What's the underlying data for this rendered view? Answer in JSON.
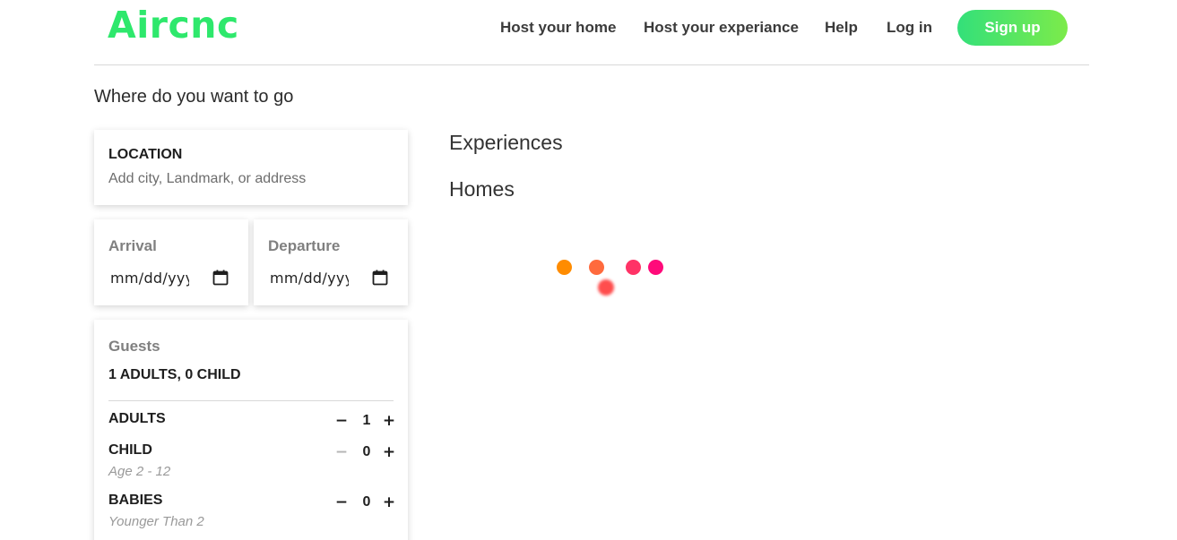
{
  "nav": {
    "logo": "Aircnc",
    "links": [
      "Host your home",
      "Host your experiance",
      "Help",
      "Log in"
    ],
    "signup_label": "Sign up"
  },
  "search": {
    "question": "Where do you want to go",
    "location": {
      "label": "LOCATION",
      "placeholder": "Add city, Landmark, or address"
    },
    "arrival": {
      "label": "Arrival",
      "value": "mm/dd/yyyy"
    },
    "departure": {
      "label": "Departure",
      "value": "mm/dd/yyyy"
    },
    "guests": {
      "label": "Guests",
      "summary": "1 ADULTS, 0 CHILD",
      "rows": [
        {
          "label": "ADULTS",
          "sub": "",
          "value": "1",
          "minus": "−",
          "plus": "+"
        },
        {
          "label": "CHILD",
          "sub": "Age 2 - 12",
          "value": "0",
          "minus": "−",
          "plus": "+"
        },
        {
          "label": "BABIES",
          "sub": "Younger Than 2",
          "value": "0",
          "minus": "−",
          "plus": "+"
        }
      ]
    }
  },
  "results": {
    "experiences_title": "Experiences",
    "homes_title": "Homes"
  },
  "colors": {
    "brand": "#2ee86c",
    "signup_gradient": [
      "#33e07a",
      "#7ceb4a"
    ],
    "loader_dots": [
      "#ff8c00",
      "#ff6a3d",
      "#ff3366",
      "#ff0a7a",
      "#ff4d4d"
    ]
  },
  "icons": {
    "calendar": "calendar-icon",
    "loader": "loading-spinner"
  }
}
